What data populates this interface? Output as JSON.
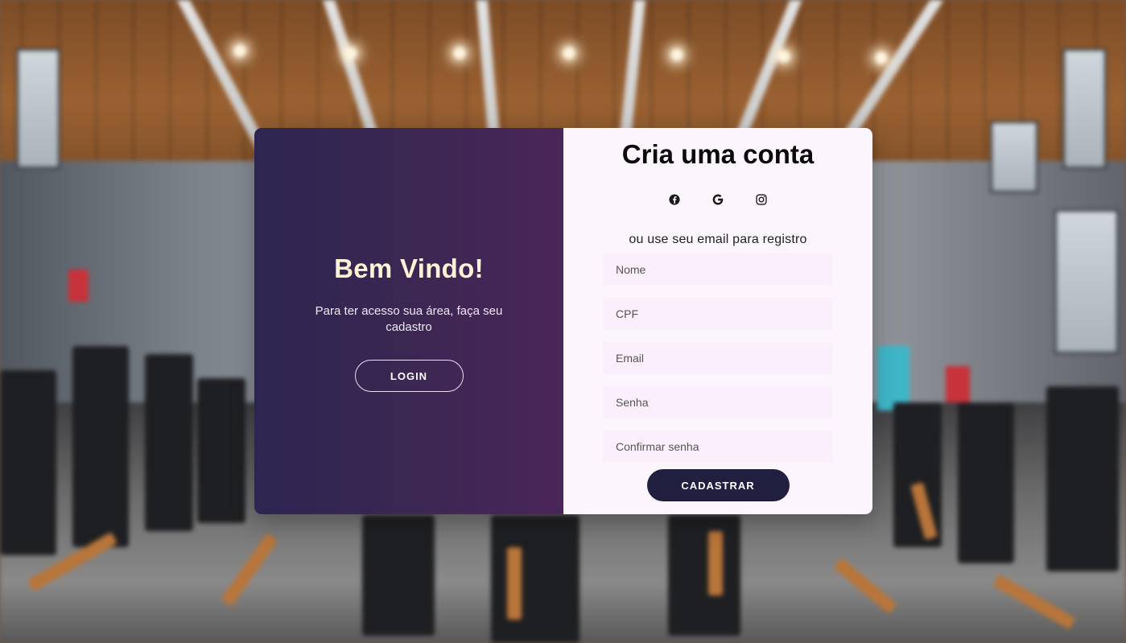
{
  "welcome": {
    "title": "Bem Vindo!",
    "text": "Para ter acesso sua área, faça seu cadastro",
    "login_label": "LOGIN"
  },
  "signup": {
    "title": "Cria uma conta",
    "social_icons": [
      "facebook-icon",
      "google-icon",
      "instagram-icon"
    ],
    "hint": "ou use seu email para registro",
    "fields": {
      "name_placeholder": "Nome",
      "cpf_placeholder": "CPF",
      "email_placeholder": "Email",
      "password_placeholder": "Senha",
      "confirm_placeholder": "Confirmar senha"
    },
    "submit_label": "CADASTRAR"
  },
  "colors": {
    "left_panel_start": "#2d2551",
    "left_panel_end": "#4a2659",
    "right_panel": "#fdf5fd",
    "field_bg": "#fbeffb",
    "button_dark": "#201f3f",
    "welcome_title": "#fff2d6"
  }
}
